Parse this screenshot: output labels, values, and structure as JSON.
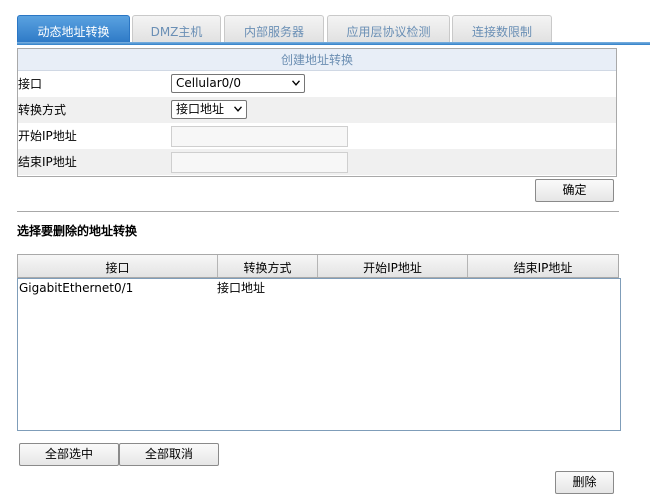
{
  "tabs": [
    {
      "label": "动态地址转换",
      "active": true
    },
    {
      "label": "DMZ主机",
      "active": false
    },
    {
      "label": "内部服务器",
      "active": false
    },
    {
      "label": "应用层协议检测",
      "active": false
    },
    {
      "label": "连接数限制",
      "active": false
    }
  ],
  "form": {
    "title": "创建地址转换",
    "interface_label": "接口",
    "interface_value": "Cellular0/0",
    "mode_label": "转换方式",
    "mode_value": "接口地址",
    "start_ip_label": "开始IP地址",
    "start_ip_value": "",
    "end_ip_label": "结束IP地址",
    "end_ip_value": "",
    "confirm_label": "确定"
  },
  "delete_section": {
    "title": "选择要删除的地址转换",
    "columns": [
      "接口",
      "转换方式",
      "开始IP地址",
      "结束IP地址"
    ],
    "rows": [
      {
        "interface": "GigabitEthernet0/1",
        "mode": "接口地址",
        "start_ip": "",
        "end_ip": ""
      }
    ],
    "select_all_label": "全部选中",
    "deselect_all_label": "全部取消",
    "delete_label": "删除"
  },
  "colors": {
    "active_tab": "#2a76c4",
    "tab_text": "#6a8fb5",
    "form_title_text": "#6b8eb2"
  }
}
